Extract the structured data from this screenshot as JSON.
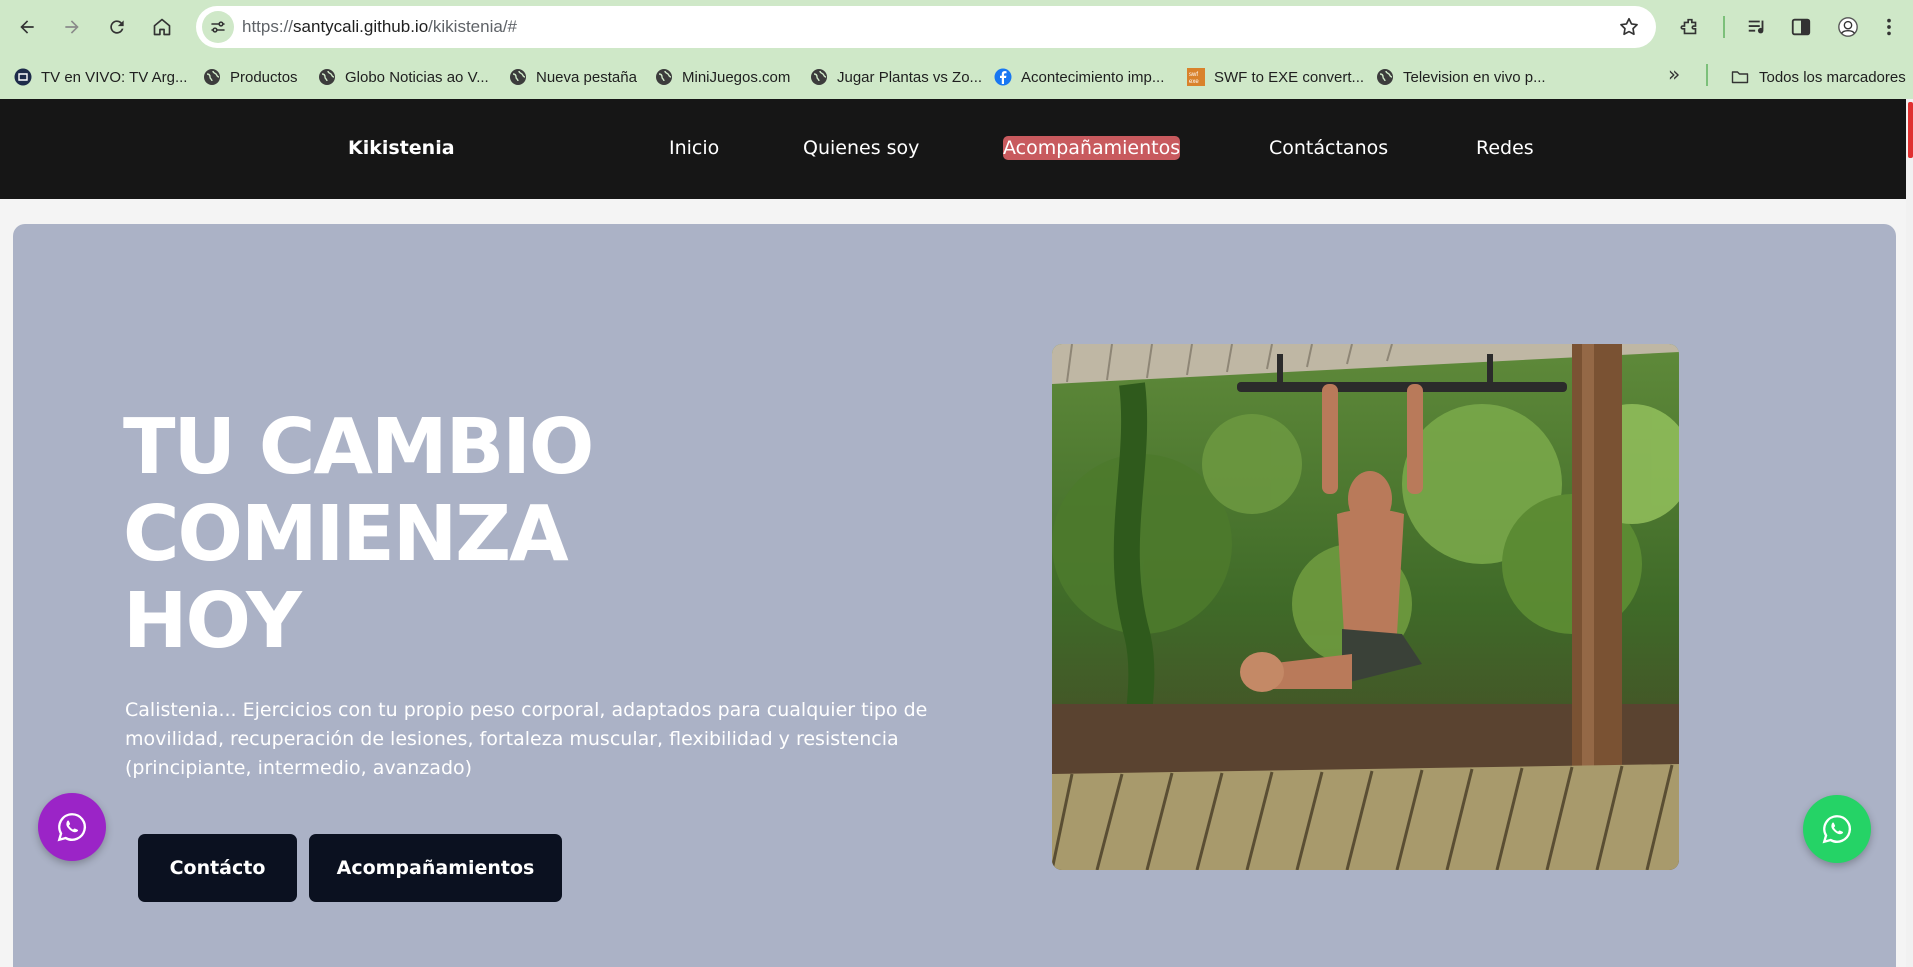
{
  "browser": {
    "url": {
      "scheme": "https://",
      "host": "santycali.github.io",
      "path": "/kikistenia/#"
    },
    "icons": [
      "back-icon",
      "forward-icon",
      "reload-icon",
      "home-icon",
      "site-info-icon",
      "star-icon",
      "extensions-icon",
      "media-icon",
      "side-panel-icon",
      "profile-icon",
      "menu-icon"
    ],
    "bookmarks": [
      {
        "label": "TV en VIVO: TV Arg...",
        "icon": "tv-favicon"
      },
      {
        "label": "Productos",
        "icon": "globe-favicon"
      },
      {
        "label": "Globo Noticias ao V...",
        "icon": "globe-favicon"
      },
      {
        "label": "Nueva pestaña",
        "icon": "globe-favicon"
      },
      {
        "label": "MiniJuegos.com",
        "icon": "globe-favicon"
      },
      {
        "label": "Jugar Plantas vs Zo...",
        "icon": "globe-favicon"
      },
      {
        "label": "Acontecimiento imp...",
        "icon": "facebook-favicon"
      },
      {
        "label": "SWF to EXE convert...",
        "icon": "swf-favicon"
      },
      {
        "label": "Television en vivo p...",
        "icon": "globe-favicon"
      }
    ],
    "bookmarks_more": "»",
    "all_bookmarks": "Todos los marcadores"
  },
  "site": {
    "brand": "Kikistenia",
    "nav": [
      "Inicio",
      "Quienes soy",
      "Acompañamientos",
      "Contáctanos",
      "Redes"
    ],
    "active_nav": "Acompañamientos",
    "hero": {
      "title_lines": [
        "TU CAMBIO",
        "COMIENZA",
        "HOY"
      ],
      "description": "Calistenia... Ejercicios con tu propio peso corporal, adaptados para cualquier tipo de movilidad, recuperación de lesiones, fortaleza muscular, flexibilidad y resistencia (principiante, intermedio, avanzado)",
      "buttons": [
        "Contácto",
        "Acompañamientos"
      ]
    },
    "colors": {
      "nav_bg": "#161616",
      "active_nav_bg": "#c85a5e",
      "hero_bg": "#abb2c6",
      "button_bg": "#0b1120",
      "whatsapp_left": "#9b24c7",
      "whatsapp_right": "#25d366"
    },
    "floating_icons": [
      "whatsapp-icon",
      "whatsapp-icon"
    ]
  }
}
